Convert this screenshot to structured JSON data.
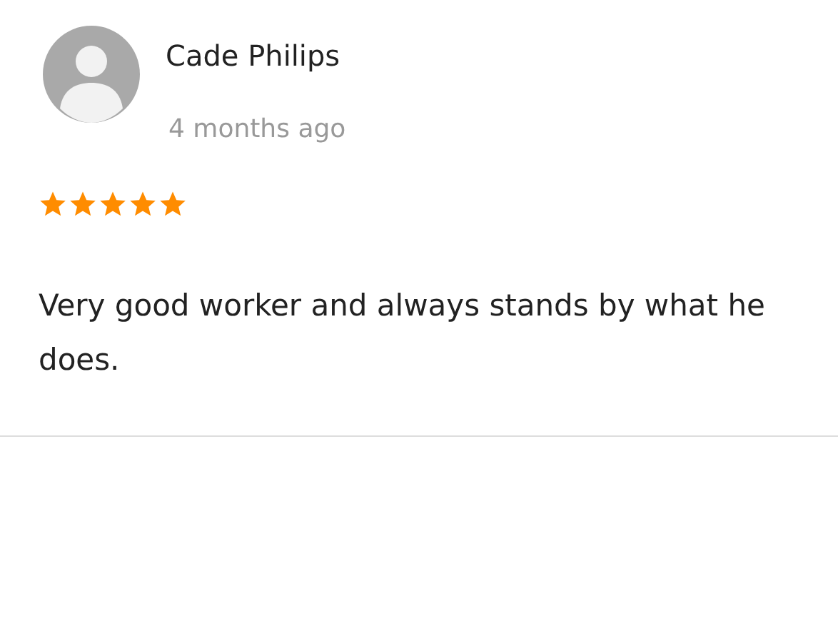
{
  "review": {
    "author": "Cade Philips",
    "time": "4 months ago",
    "stars": 5,
    "text": "Very good worker and always stands by what he does."
  }
}
